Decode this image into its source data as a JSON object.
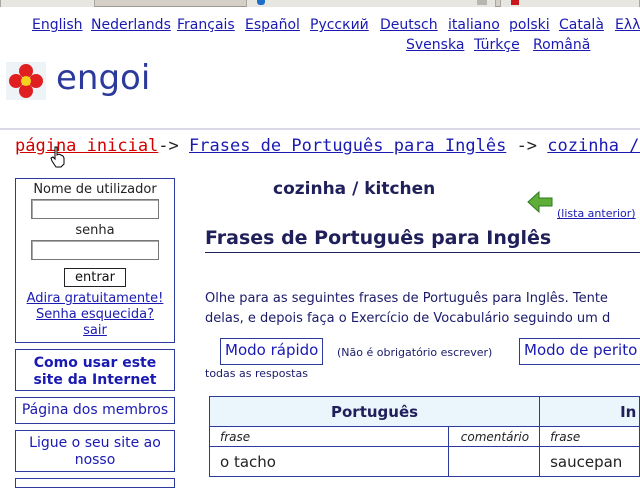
{
  "languages": [
    "English",
    "Nederlands",
    "Français",
    "Español",
    "Русский",
    "Deutsch",
    "italiano",
    "polski",
    "Català",
    "Ελλ",
    "Svenska",
    "Türkçe",
    "Română"
  ],
  "logo": {
    "text": "engoi"
  },
  "breadcrumb": {
    "home": "página inicial",
    "sep": "->",
    "level1": "Frases de Português para Inglês",
    "level2": "cozinha / kitc"
  },
  "login": {
    "username_label": "Nome de utilizador",
    "password_label": "senha",
    "submit_label": "entrar",
    "join_link": "Adira gratuitamente!",
    "forgot_link": "Senha esquecida?",
    "logout_link": "sair"
  },
  "sidebar_menu": [
    "Como usar este site da Internet",
    "Página dos membros",
    "Ligue o seu site ao nosso"
  ],
  "main": {
    "page_heading": "cozinha / kitchen",
    "prev_list_link": "(lista anterior)",
    "section_title": "Frases de Português para Inglês",
    "intro_line1": "Olhe para as seguintes frases de Português para Inglês. Tente",
    "intro_line2": "delas, e depois faça o Exercício de Vocabulário seguindo um d",
    "mode_fast": "Modo rápido",
    "mode_fast_note": "(Não é obrigatório escrever)",
    "mode_expert": "Modo de perito",
    "all_answers": "todas as respostas"
  },
  "table": {
    "col_pt": "Português",
    "col_en": "In",
    "sub_phrase": "frase",
    "sub_comment": "comentário",
    "sub_phrase_en": "frase",
    "rows": [
      {
        "pt": "o tacho",
        "comment": "",
        "en": "saucepan"
      }
    ]
  },
  "colors": {
    "link": "#1a1ab3",
    "home_link": "#d10000",
    "heading": "#1f1f5a",
    "table_header_bg": "#ebf5fc",
    "border": "#2b3a9b"
  }
}
